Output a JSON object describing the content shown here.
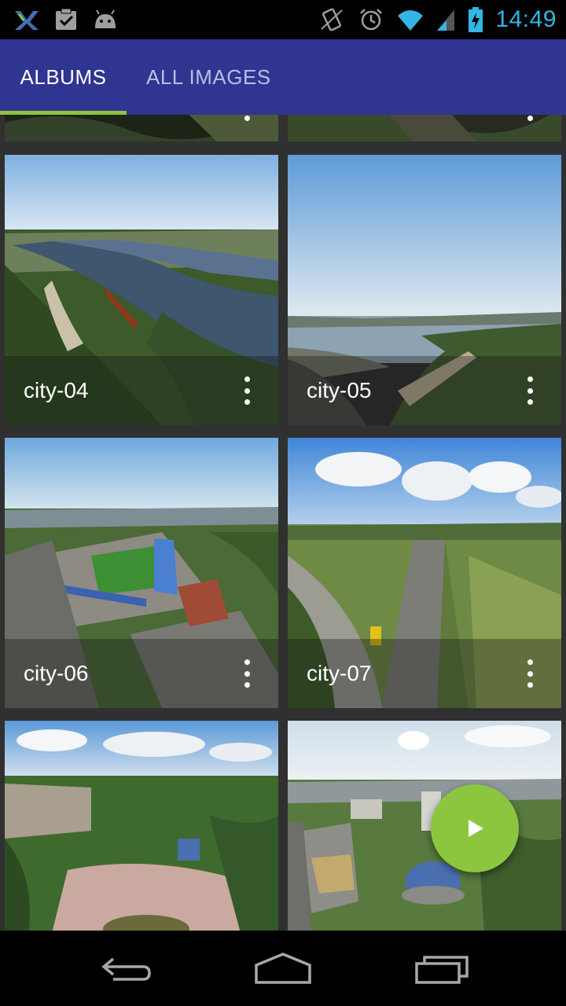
{
  "status_bar": {
    "time": "14:49",
    "left_icons": [
      "app-x-icon",
      "clipboard-check-icon",
      "android-icon"
    ],
    "right_icons": [
      "vibrate-icon",
      "alarm-icon",
      "wifi-icon",
      "signal-icon",
      "battery-charging-icon"
    ],
    "time_color": "#33b5e5"
  },
  "tabs": [
    {
      "label": "ALBUMS",
      "selected": true
    },
    {
      "label": "ALL IMAGES",
      "selected": false
    }
  ],
  "colors": {
    "tabbar": "#303591",
    "accent": "#8cc63f",
    "grid_bg": "#303030"
  },
  "albums": [
    {
      "name": "city-04",
      "menu_icon": "more-vert-icon"
    },
    {
      "name": "city-05",
      "menu_icon": "more-vert-icon"
    },
    {
      "name": "city-06",
      "menu_icon": "more-vert-icon"
    },
    {
      "name": "city-07",
      "menu_icon": "more-vert-icon"
    }
  ],
  "fab": {
    "icon": "play-icon"
  },
  "nav_bar": {
    "icons": [
      "back-icon",
      "home-icon",
      "recent-apps-icon"
    ]
  }
}
